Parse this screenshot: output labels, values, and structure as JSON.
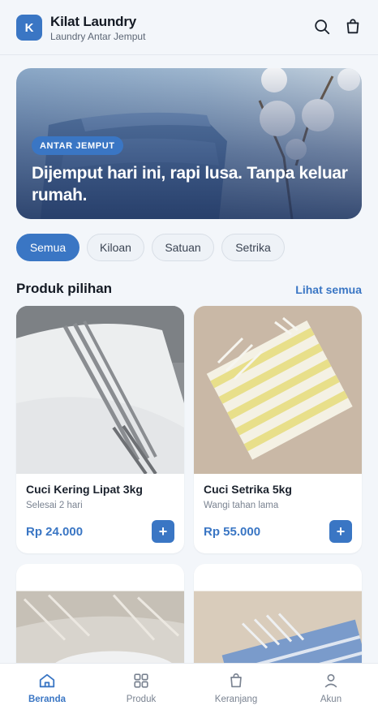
{
  "header": {
    "logo_letter": "K",
    "app_name": "Kilat Laundry",
    "tagline": "Laundry Antar Jemput",
    "icons": [
      "search-icon",
      "shopping-bag-icon"
    ]
  },
  "hero": {
    "badge": "ANTAR JEMPUT",
    "title": "Dijemput hari ini, rapi lusa. Tanpa keluar rumah."
  },
  "filters": {
    "chips": [
      "Semua",
      "Kiloan",
      "Satuan",
      "Setrika"
    ],
    "active": "Semua"
  },
  "section": {
    "title": "Produk pilihan",
    "see_all": "Lihat semua"
  },
  "products": [
    {
      "name": "Cuci Kering Lipat 3kg",
      "duration": "Selesai 2 hari",
      "price": "Rp 24.000",
      "add": "+"
    },
    {
      "name": "Cuci Setrika 5kg",
      "duration": "Wangi tahan lama",
      "price": "Rp 55.000",
      "add": "+"
    }
  ],
  "nav": {
    "items": [
      {
        "label": "Beranda",
        "icon": "home-icon",
        "active": true
      },
      {
        "label": "Produk",
        "icon": "grid-icon",
        "active": false
      },
      {
        "label": "Keranjang",
        "icon": "bag-icon",
        "active": false
      },
      {
        "label": "Akun",
        "icon": "user-icon",
        "active": false
      }
    ]
  },
  "colors": {
    "accent": "#3a76c4",
    "background": "#f3f6fa"
  }
}
